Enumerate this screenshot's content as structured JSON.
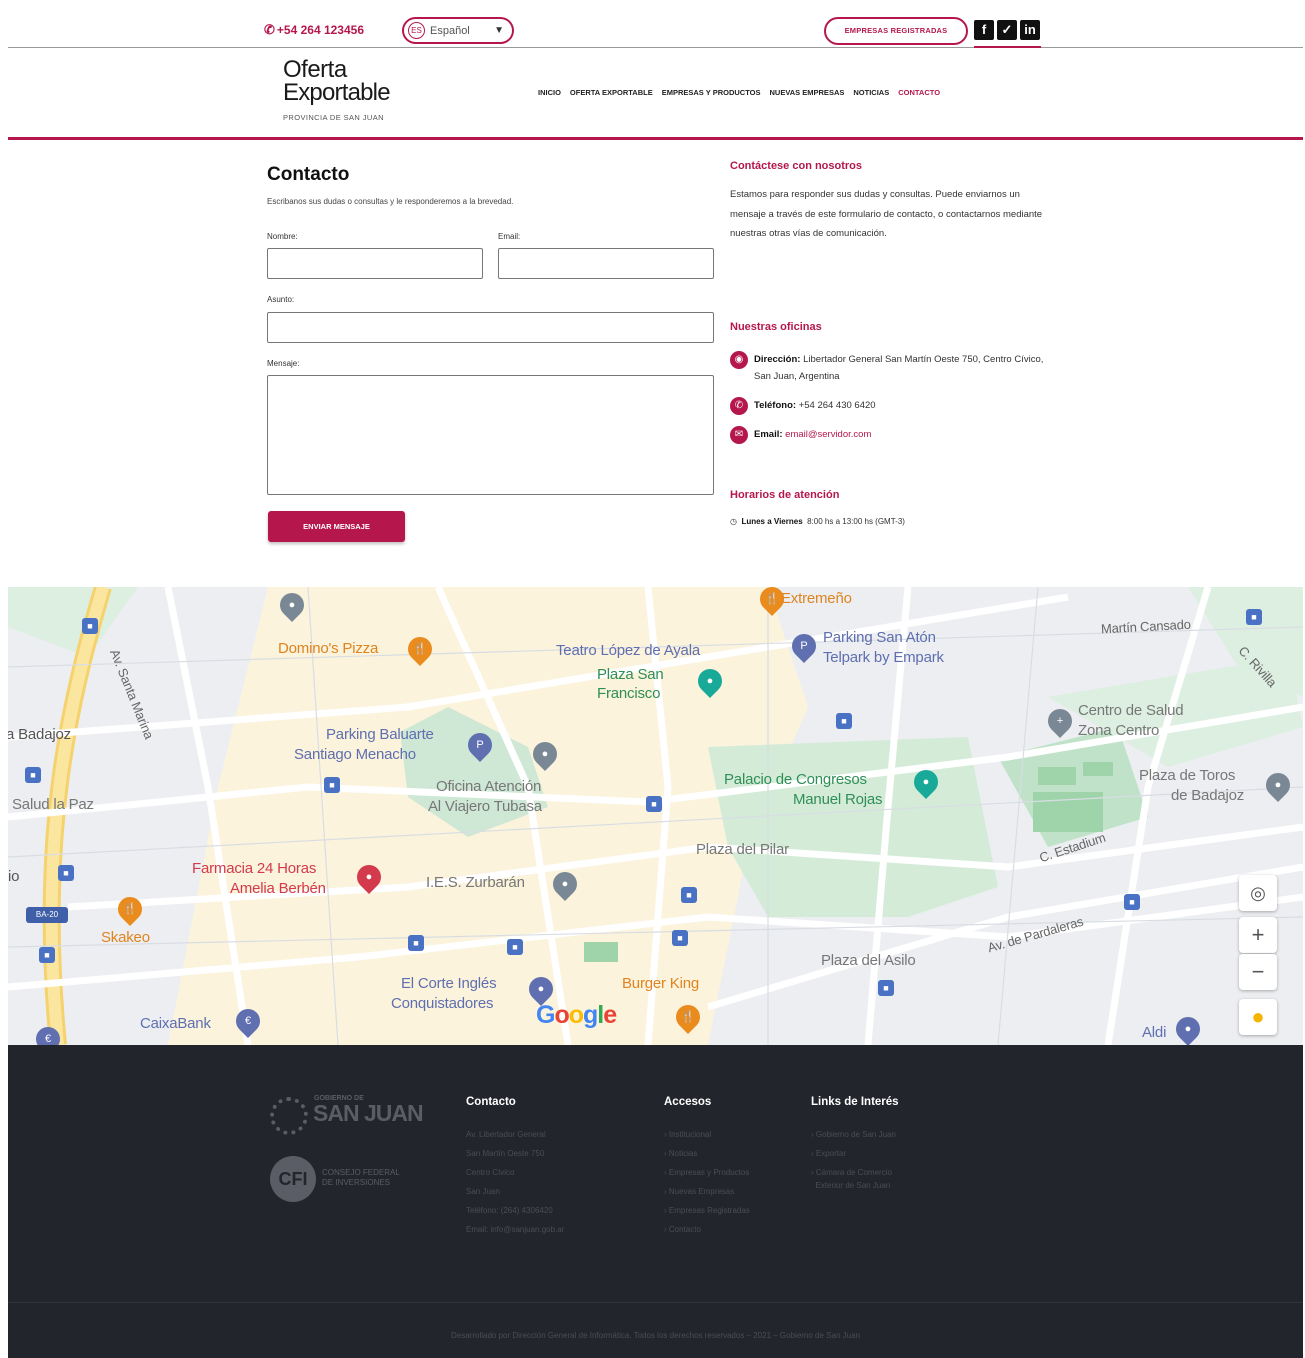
{
  "topbar": {
    "phone": "+54 264 123456",
    "language_code": "ES",
    "language": "Español",
    "registered_button": "EMPRESAS REGISTRADAS",
    "social": [
      "f",
      "t",
      "in"
    ]
  },
  "header": {
    "logo_line1": "Oferta",
    "logo_line2": "Exportable",
    "logo_sub": "PROVINCIA DE SAN JUAN",
    "nav": [
      "INICIO",
      "OFERTA EXPORTABLE",
      "EMPRESAS Y PRODUCTOS",
      "NUEVAS EMPRESAS",
      "NOTICIAS",
      "CONTACTO"
    ],
    "active_nav": "CONTACTO"
  },
  "form": {
    "title": "Contacto",
    "subtitle": "Escribanos sus dudas o consultas y le responderemos a la brevedad.",
    "name_label": "Nombre:",
    "email_label": "Email:",
    "subject_label": "Asunto:",
    "message_label": "Mensaje:",
    "name_value": "",
    "email_value": "",
    "subject_value": "",
    "message_value": "",
    "submit": "ENVIAR MENSAJE"
  },
  "info": {
    "contact_title": "Contáctese con nosotros",
    "contact_text": "Estamos para responder sus dudas y consultas. Puede enviarnos un mensaje a través de este formulario de contacto, o contactarnos mediante nuestras otras vías de comunicación.",
    "offices_title": "Nuestras oficinas",
    "address_label": "Dirección:",
    "address_value": "Libertador General San Martín Oeste 750, Centro Cívico, San Juan, Argentina",
    "phone_label": "Teléfono:",
    "phone_value": "+54 264 430 6420",
    "email_label": "Email:",
    "email_value": "email@servidor.com",
    "hours_title": "Horarios de atención",
    "hours_label": "Lunes a Viernes",
    "hours_value": "8:00 hs a 13:00 hs (GMT-3)"
  },
  "map": {
    "labels": {
      "extremeno": "Extremeño",
      "dominos": "Domino's Pizza",
      "teatro": "Teatro López de Ayala",
      "plaza_sf1": "Plaza San",
      "plaza_sf2": "Francisco",
      "parking_aton1": "Parking San Atón",
      "parking_aton2": "Telpark by Empark",
      "martin": "Martín Cansado",
      "rivilla": "C. Rivilla",
      "badajoz": "a Badajoz",
      "santa_marina": "Av. Santa Marina",
      "parking_baluarte1": "Parking Baluarte",
      "parking_baluarte2": "Santiago Menacho",
      "oficina1": "Oficina Atención",
      "oficina2": "Al Viajero Tubasa",
      "centro_salud1": "Centro de Salud",
      "centro_salud2": "Zona Centro",
      "salud_paz": "Salud la Paz",
      "palacio1": "Palacio de Congresos",
      "palacio2": "Manuel Rojas",
      "plaza_toros1": "Plaza de Toros",
      "plaza_toros2": "de Badajoz",
      "plaza_pilar": "Plaza del Pilar",
      "estadium": "C. Estadium",
      "farmacia1": "Farmacia 24 Horas",
      "farmacia2": "Amelia Berbén",
      "ies": "I.E.S. Zurbarán",
      "skakeo": "Skakeo",
      "ba20": "BA-20",
      "pardaleras": "Av. de Pardaleras",
      "plaza_asilo": "Plaza del Asilo",
      "corte1": "El Corte Inglés",
      "corte2": "Conquistadores",
      "burger": "Burger King",
      "caixa": "CaixaBank",
      "aldi": "Aldi",
      "io": "io"
    },
    "google": "Google",
    "zoom_in": "+",
    "zoom_out": "−"
  },
  "footer": {
    "gov_small": "GOBIERNO DE",
    "gov_name": "SAN JUAN",
    "cfi_mark": "CFI",
    "cfi_text": "CONSEJO FEDERAL DE INVERSIONES",
    "contact_title": "Contacto",
    "contact_lines": [
      "Av. Libertador General",
      "San Martín Oeste 750",
      "Centro Cívico",
      "San Juan",
      "Teléfono: (264) 4306420",
      "Email: info@sanjuan.gob.ar"
    ],
    "access_title": "Accesos",
    "access_lines": [
      "› Institucional",
      "› Noticias",
      "› Empresas y Productos",
      "› Nuevas Empresas",
      "› Empresas Registradas",
      "› Contacto"
    ],
    "links_title": "Links de Interés",
    "links_lines": [
      "› Gobierno de San Juan",
      "› Exportar",
      "› Cámara de Comercio",
      "  Exterior de San Juan"
    ],
    "copyright": "Desarrollado por Dirección General de Informática. Todos los derechos reservados – 2021 – Gobierno de San Juan"
  }
}
